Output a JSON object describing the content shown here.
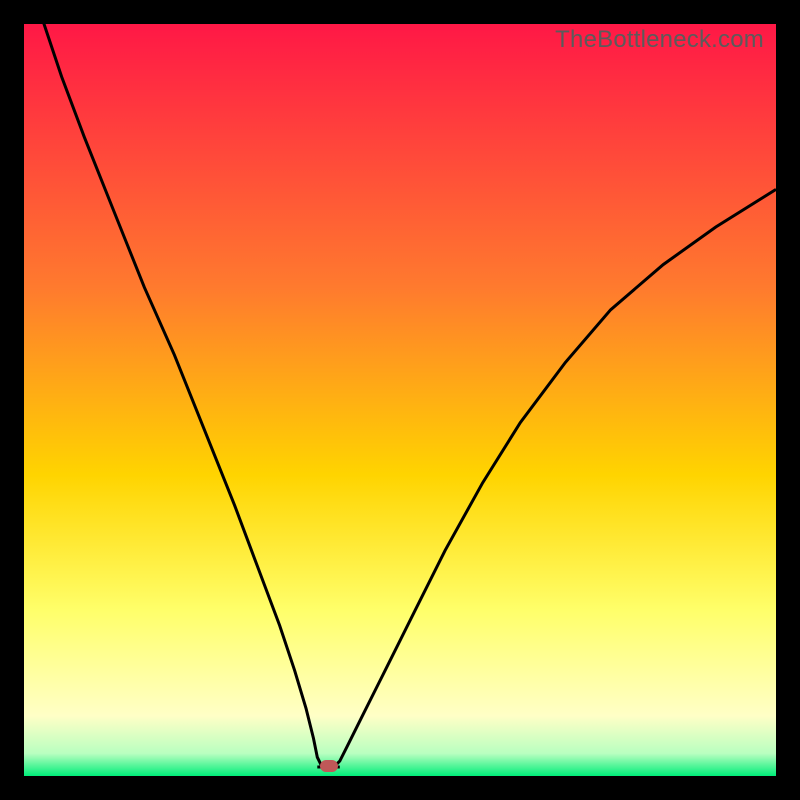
{
  "watermark": "TheBottleneck.com",
  "colors": {
    "frame_bg": "#000000",
    "grad_top": "#ff1846",
    "grad_mid_upper": "#ff7a2e",
    "grad_mid": "#ffd400",
    "grad_mid_lower": "#ffff6a",
    "grad_yellow_pale": "#ffffc6",
    "grad_green": "#00ed79",
    "curve_stroke": "#000000",
    "marker_fill": "#c05858"
  },
  "chart_data": {
    "type": "line",
    "title": "",
    "xlabel": "",
    "ylabel": "",
    "xlim": [
      0,
      100
    ],
    "ylim": [
      0,
      100
    ],
    "series": [
      {
        "name": "bottleneck-curve",
        "x": [
          0,
          2,
          5,
          8,
          12,
          16,
          20,
          24,
          28,
          31,
          34,
          36,
          37.5,
          38.5,
          39,
          39.5,
          41.5,
          42,
          43,
          45,
          48,
          52,
          56,
          61,
          66,
          72,
          78,
          85,
          92,
          100
        ],
        "y": [
          108,
          102,
          93,
          85,
          75,
          65,
          56,
          46,
          36,
          28,
          20,
          14,
          9,
          5,
          2.5,
          1.5,
          1.5,
          2,
          4,
          8,
          14,
          22,
          30,
          39,
          47,
          55,
          62,
          68,
          73,
          78
        ]
      }
    ],
    "marker": {
      "x": 40.5,
      "y": 1.3
    },
    "flat_bottom": {
      "x0": 39,
      "x1": 42,
      "y": 1.2
    }
  }
}
